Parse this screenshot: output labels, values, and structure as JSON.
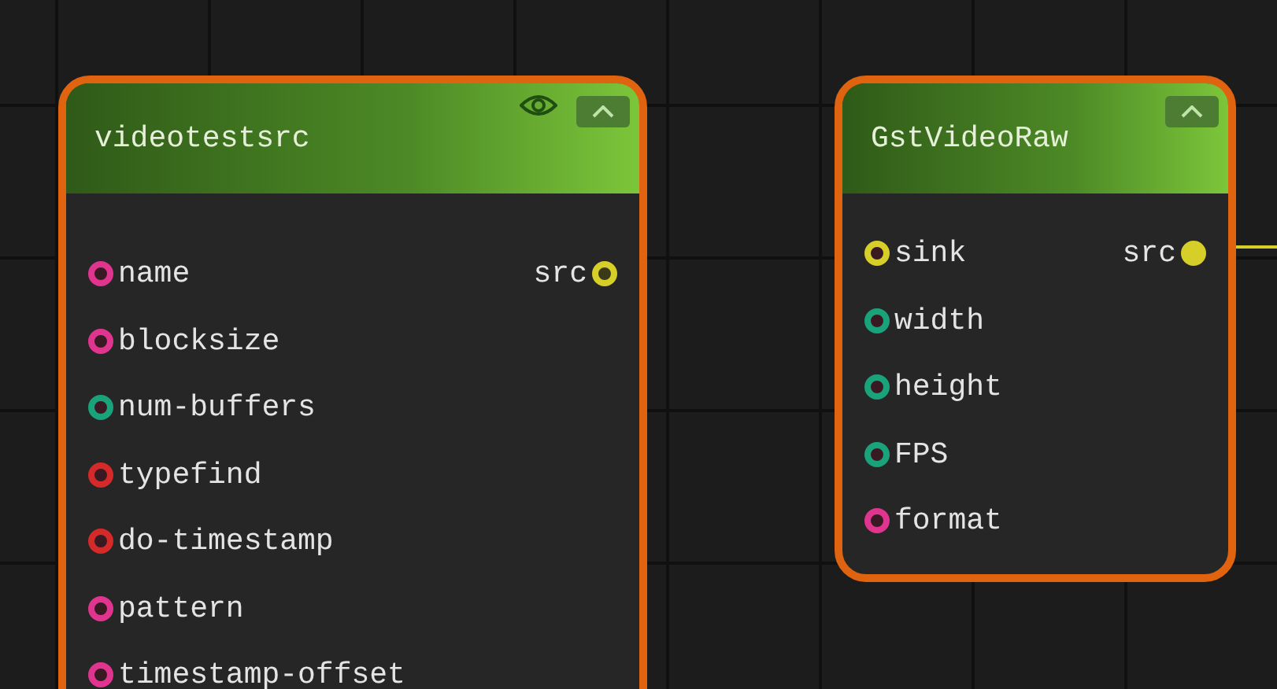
{
  "nodes": [
    {
      "title": "videotestsrc",
      "visibility_toggle": true,
      "inputs": [
        {
          "label": "name",
          "color": "#e0358f"
        },
        {
          "label": "blocksize",
          "color": "#e0358f"
        },
        {
          "label": "num-buffers",
          "color": "#1aa37a"
        },
        {
          "label": "typefind",
          "color": "#d42a2a"
        },
        {
          "label": "do-timestamp",
          "color": "#d42a2a"
        },
        {
          "label": "pattern",
          "color": "#e0358f"
        },
        {
          "label": "timestamp-offset",
          "color": "#e0358f"
        }
      ],
      "outputs": [
        {
          "label": "src",
          "color": "#d6cf2a",
          "connected": false
        }
      ]
    },
    {
      "title": "GstVideoRaw",
      "visibility_toggle": false,
      "inputs": [
        {
          "label": "sink",
          "color": "#d6cf2a"
        },
        {
          "label": "width",
          "color": "#1aa37a"
        },
        {
          "label": "height",
          "color": "#1aa37a"
        },
        {
          "label": "FPS",
          "color": "#1aa37a"
        },
        {
          "label": "format",
          "color": "#e0358f"
        }
      ],
      "outputs": [
        {
          "label": "src",
          "color": "#d6cf2a",
          "connected": true
        }
      ]
    }
  ]
}
